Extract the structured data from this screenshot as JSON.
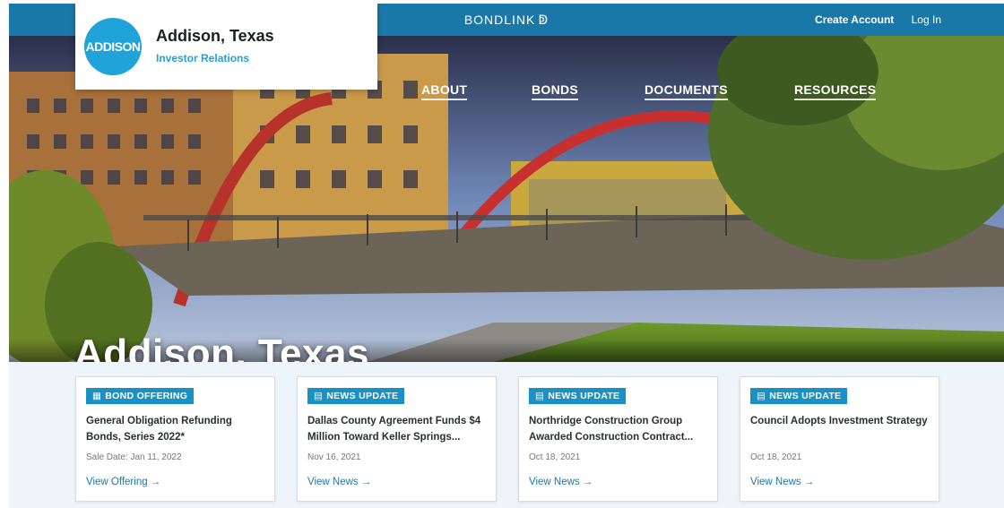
{
  "topbar": {
    "brand": "BONDLINK",
    "brand_icon": "bondlink-swirl-icon",
    "create_account": "Create Account",
    "log_in": "Log In",
    "color": "#1a78a8"
  },
  "logo": {
    "badge_text": "ADDISON",
    "title": "Addison, Texas",
    "subtitle": "Investor Relations",
    "accent": "#1fa3d8"
  },
  "nav": {
    "items": [
      {
        "label": "ABOUT"
      },
      {
        "label": "BONDS"
      },
      {
        "label": "DOCUMENTS"
      },
      {
        "label": "RESOURCES"
      }
    ]
  },
  "hero": {
    "title": "Addison, Texas"
  },
  "cards": [
    {
      "badge": "BOND OFFERING",
      "badge_icon": "offering-icon",
      "title": "General Obligation Refunding Bonds, Series 2022*",
      "date": "Sale Date: Jan 11, 2022",
      "link": "View Offering →"
    },
    {
      "badge": "NEWS UPDATE",
      "badge_icon": "news-icon",
      "title": "Dallas County Agreement Funds $4 Million Toward Keller Springs...",
      "date": "Nov 16, 2021",
      "link": "View News →"
    },
    {
      "badge": "NEWS UPDATE",
      "badge_icon": "news-icon",
      "title": "Northridge Construction Group Awarded Construction Contract...",
      "date": "Oct 18, 2021",
      "link": "View News →"
    },
    {
      "badge": "NEWS UPDATE",
      "badge_icon": "news-icon",
      "title": "Council Adopts Investment Strategy",
      "date": "Oct 18, 2021",
      "link": "View News →"
    }
  ]
}
